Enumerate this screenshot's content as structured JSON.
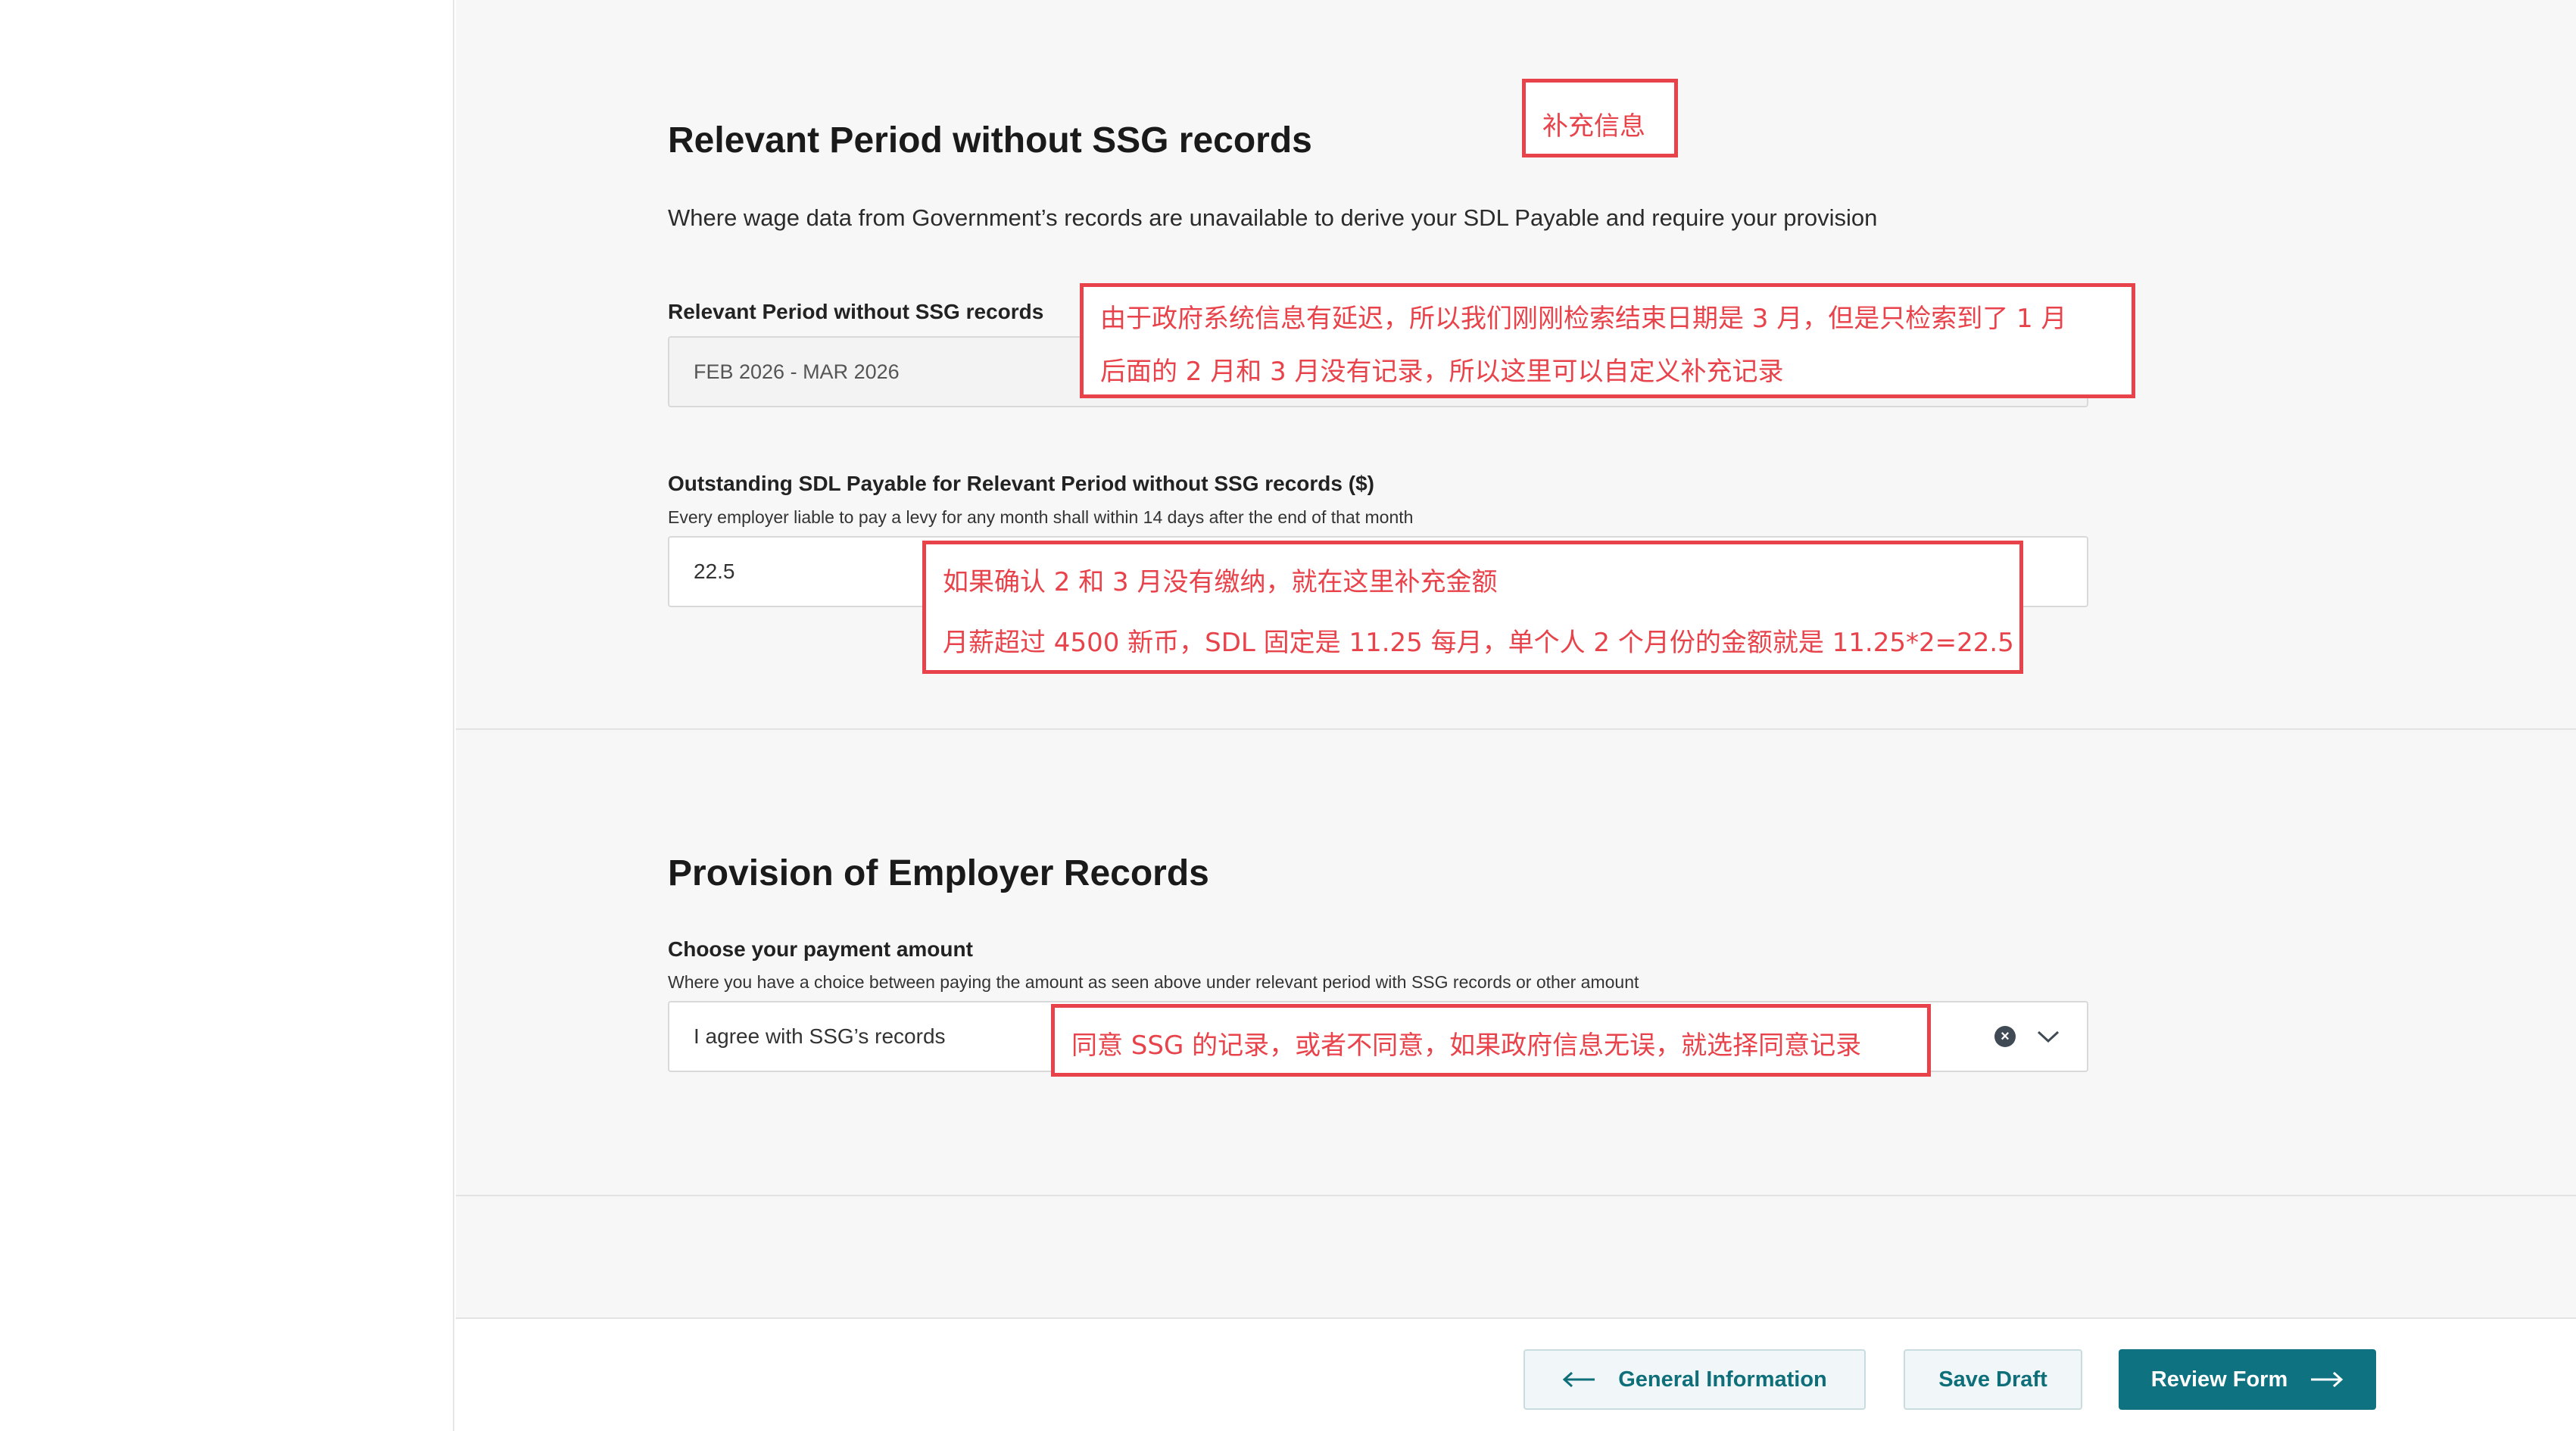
{
  "section1": {
    "title": "Relevant Period without SSG records",
    "description": "Where wage data from Government’s records are unavailable to derive your SDL Payable and require your provision",
    "period_field": {
      "label": "Relevant Period without SSG records",
      "value": "FEB 2026 - MAR 2026"
    },
    "payable_field": {
      "label": "Outstanding SDL Payable for Relevant Period without SSG records ($)",
      "help": "Every employer liable to pay a levy for any month shall within 14 days after the end of that month",
      "value": "22.5"
    }
  },
  "section2": {
    "title": "Provision of Employer Records",
    "payment_field": {
      "label": "Choose your payment amount",
      "help": "Where you have a choice between paying the amount as seen above under relevant period with SSG records or other amount",
      "selected": "I agree with SSG’s records"
    }
  },
  "annotations": {
    "header_note": "补充信息",
    "period_note_line1": "由于政府系统信息有延迟，所以我们刚刚检索结束日期是 3 月，但是只检索到了 1 月",
    "period_note_line2": "后面的 2 月和 3 月没有记录，所以这里可以自定义补充记录",
    "payable_note_line1": "如果确认 2 和 3 月没有缴纳，就在这里补充金额",
    "payable_note_line2": "月薪超过 4500 新币，SDL 固定是 11.25 每月，单个人 2 个月份的金额就是 11.25*2=22.5",
    "payment_note": "同意 SSG 的记录，或者不同意，如果政府信息无误，就选择同意记录"
  },
  "footer": {
    "back_label": "General Information",
    "draft_label": "Save Draft",
    "review_label": "Review Form"
  },
  "colors": {
    "accent": "#0e7280",
    "annotation": "#e8424a"
  }
}
